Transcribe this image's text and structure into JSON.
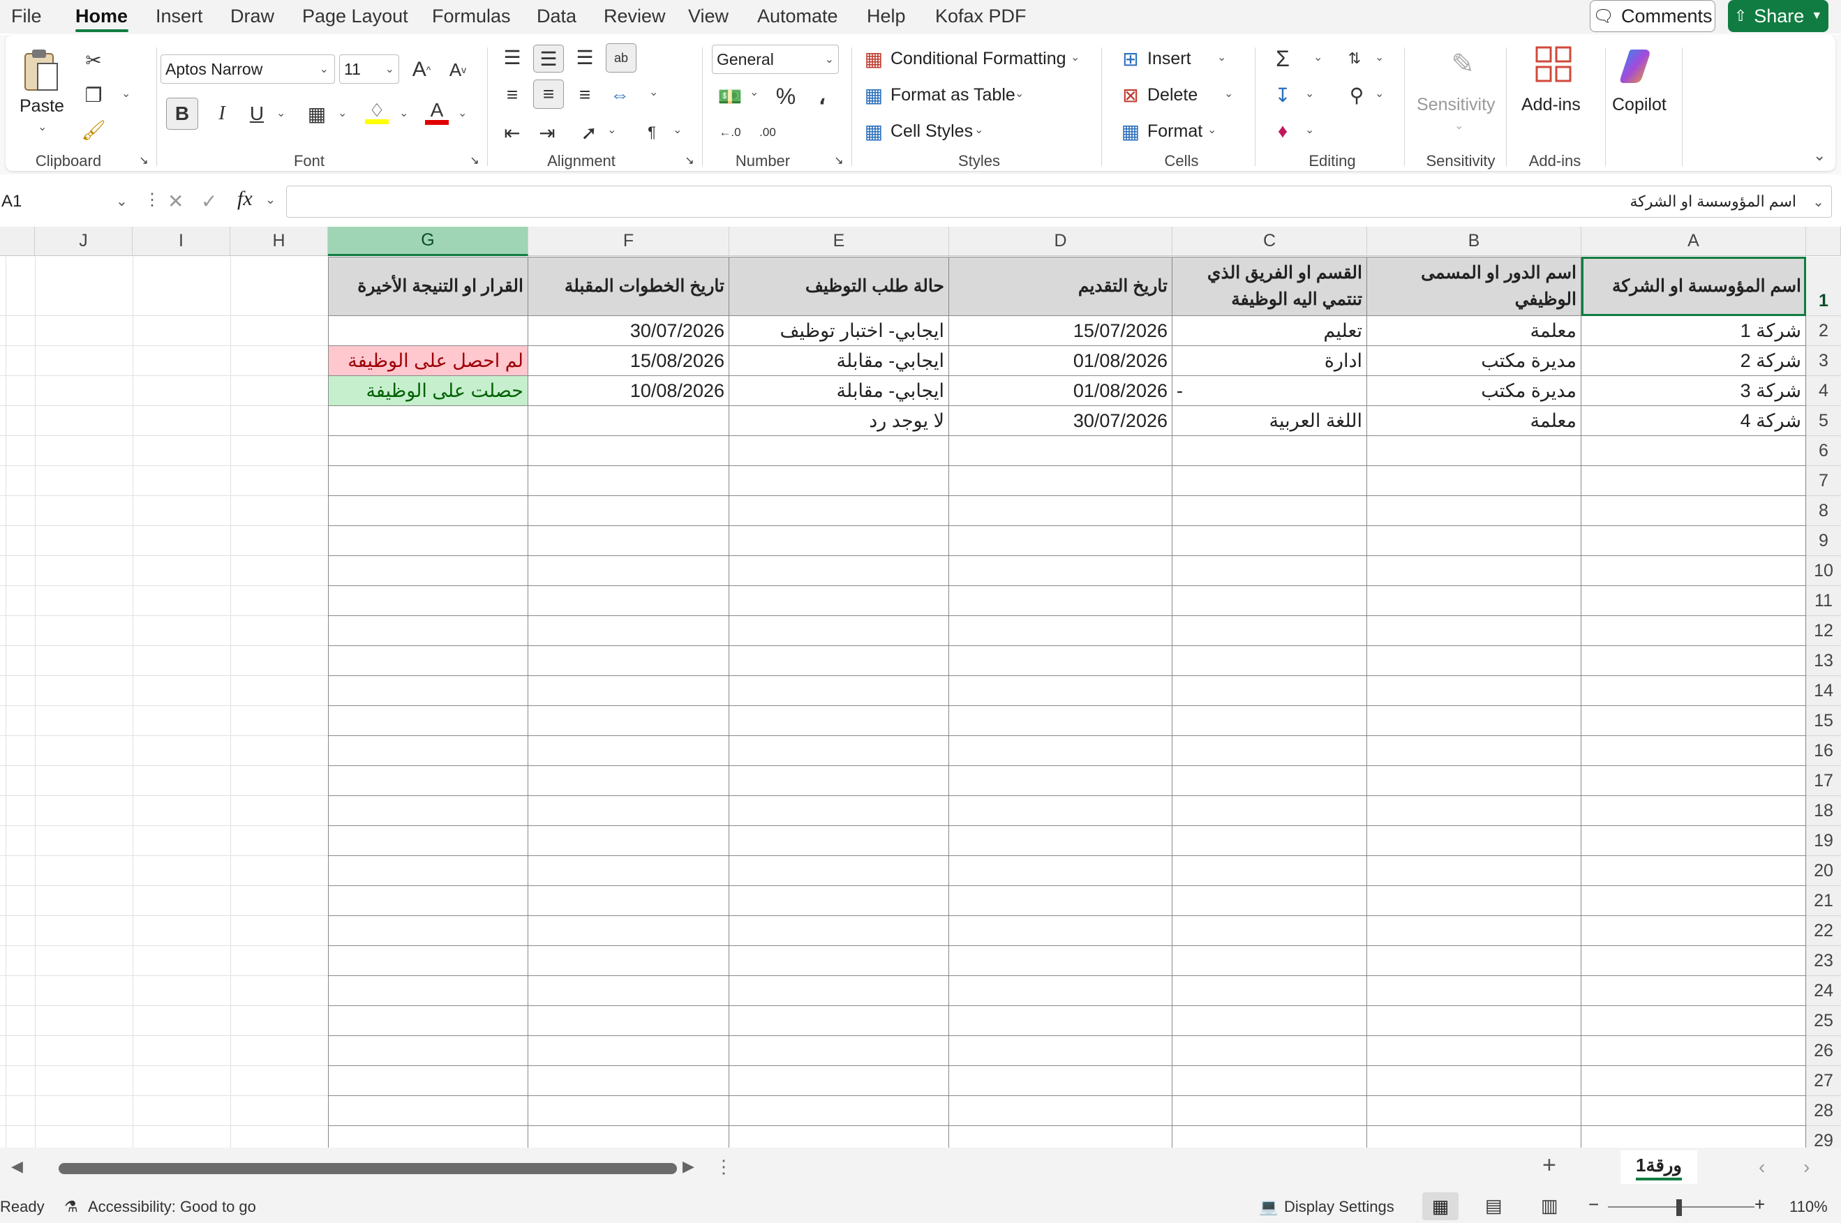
{
  "menu": {
    "tabs": [
      "File",
      "Home",
      "Insert",
      "Draw",
      "Page Layout",
      "Formulas",
      "Data",
      "Review",
      "View",
      "Automate",
      "Help",
      "Kofax PDF"
    ],
    "active_tab": "Home",
    "comments_label": "Comments",
    "share_label": "Share"
  },
  "ribbon": {
    "clipboard": {
      "paste_label": "Paste",
      "group_label": "Clipboard"
    },
    "font": {
      "font_name": "Aptos Narrow",
      "font_size": "11",
      "group_label": "Font"
    },
    "alignment": {
      "group_label": "Alignment"
    },
    "number": {
      "format": "General",
      "group_label": "Number"
    },
    "styles": {
      "conditional_formatting": "Conditional Formatting",
      "format_as_table": "Format as Table",
      "cell_styles": "Cell Styles",
      "group_label": "Styles"
    },
    "cells": {
      "insert": "Insert",
      "delete": "Delete",
      "format": "Format",
      "group_label": "Cells"
    },
    "editing": {
      "group_label": "Editing"
    },
    "sensitivity": {
      "label": "Sensitivity",
      "group_label": "Sensitivity"
    },
    "addins": {
      "label": "Add-ins",
      "group_label": "Add-ins"
    },
    "copilot": {
      "label": "Copilot"
    }
  },
  "formula_bar": {
    "name_box": "A1",
    "fx": "fx",
    "content": "اسم المؤوسسة او الشركة"
  },
  "grid": {
    "columns": [
      "A",
      "B",
      "C",
      "D",
      "E",
      "F",
      "G",
      "H",
      "I",
      "J"
    ],
    "selected_column": "G",
    "rows": [
      "1",
      "2",
      "3",
      "4",
      "5",
      "6",
      "7",
      "8",
      "9",
      "10",
      "11",
      "12",
      "13",
      "14",
      "15",
      "16",
      "17",
      "18",
      "19",
      "20",
      "21",
      "22",
      "23",
      "24",
      "25",
      "26",
      "27",
      "28",
      "29"
    ],
    "headers": {
      "A": "اسم المؤوسسة او الشركة",
      "B": "اسم الدور او المسمى الوظيفي",
      "C": "القسم او الفريق الذي تنتمي اليه الوظيفة",
      "D": "تاريخ التقديم",
      "E": "حالة طلب التوظيف",
      "F": "تاريخ الخطوات المقبلة",
      "G": "القرار او التنيجة الأخيرة"
    },
    "data_rows": [
      {
        "A": "شركة 1",
        "B": "معلمة",
        "C": "تعليم",
        "D": "15/07/2026",
        "E": "ايجابي- اختبار توظيف",
        "F": "30/07/2026",
        "G": ""
      },
      {
        "A": "شركة 2",
        "B": "مديرة مكتب",
        "C": "ادارة",
        "D": "01/08/2026",
        "E": "ايجابي- مقابلة",
        "F": "15/08/2026",
        "G": "لم احصل على الوظيفة"
      },
      {
        "A": "شركة 3",
        "B": "مديرة مكتب",
        "C": "-",
        "D": "01/08/2026",
        "E": "ايجابي- مقابلة",
        "F": "10/08/2026",
        "G": "حصلت على الوظيفة"
      },
      {
        "A": "شركة 4",
        "B": "معلمة",
        "C": "اللغة العربية",
        "D": "30/07/2026",
        "E": "لا يوجد رد",
        "F": "",
        "G": ""
      }
    ],
    "colors": {
      "rejected_bg": "#ffc7ce",
      "rejected_fg": "#9c0006",
      "accepted_bg": "#c6efce",
      "accepted_fg": "#006100"
    }
  },
  "sheets": {
    "active": "ورقة1"
  },
  "status": {
    "ready": "Ready",
    "accessibility": "Accessibility: Good to go",
    "display_settings": "Display Settings",
    "zoom": "110%"
  }
}
